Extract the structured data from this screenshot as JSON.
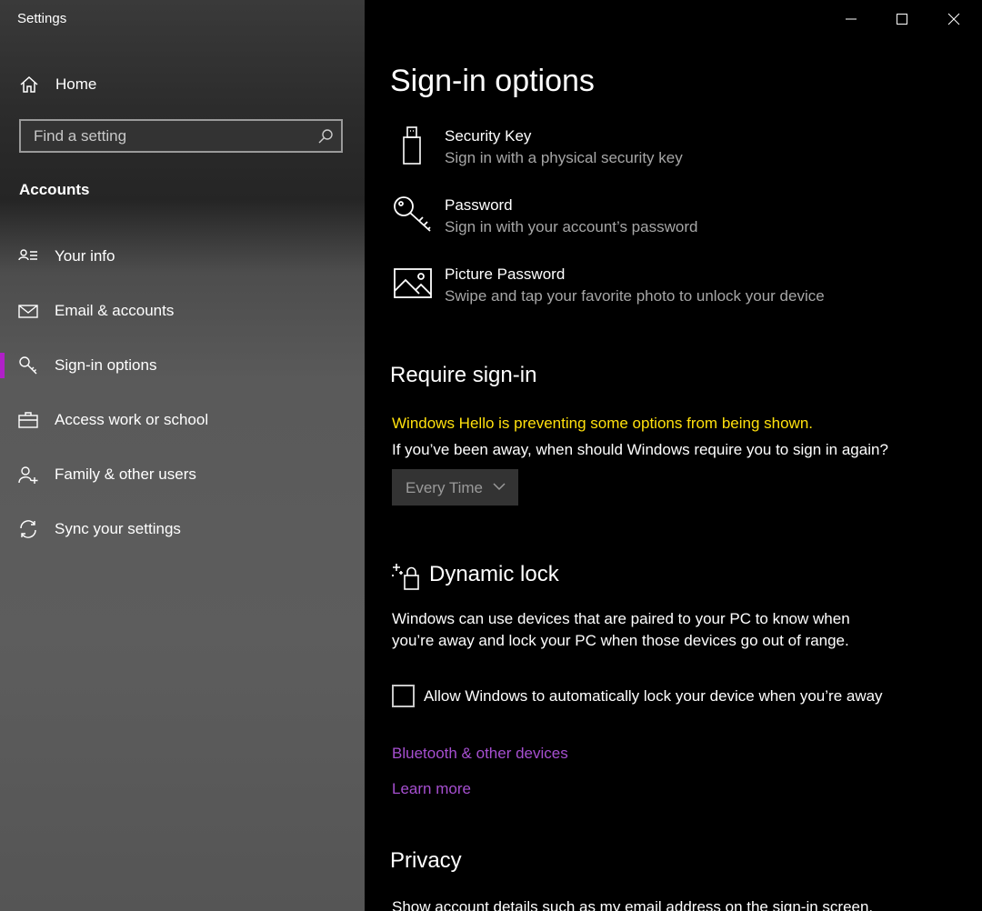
{
  "window": {
    "title": "Settings"
  },
  "sidebar": {
    "home_label": "Home",
    "search_placeholder": "Find a setting",
    "section": "Accounts",
    "items": [
      {
        "label": "Your info",
        "icon": "person-list-icon"
      },
      {
        "label": "Email & accounts",
        "icon": "mail-icon"
      },
      {
        "label": "Sign-in options",
        "icon": "key-icon",
        "active": true
      },
      {
        "label": "Access work or school",
        "icon": "briefcase-icon"
      },
      {
        "label": "Family & other users",
        "icon": "person-add-icon"
      },
      {
        "label": "Sync your settings",
        "icon": "sync-icon"
      }
    ],
    "accent_color": "#b020c8"
  },
  "main": {
    "title": "Sign-in options",
    "options": [
      {
        "title": "Security Key",
        "subtitle": "Sign in with a physical security key",
        "icon": "usb-key-icon"
      },
      {
        "title": "Password",
        "subtitle": "Sign in with your account’s password",
        "icon": "key-icon"
      },
      {
        "title": "Picture Password",
        "subtitle": "Swipe and tap your favorite photo to unlock your device",
        "icon": "picture-icon"
      }
    ],
    "require_signin": {
      "heading": "Require sign-in",
      "warning": "Windows Hello is preventing some options from being shown.",
      "question": "If you’ve been away, when should Windows require you to sign in again?",
      "dropdown_value": "Every Time"
    },
    "dynamic_lock": {
      "heading": "Dynamic lock",
      "description_line1": "Windows can use devices that are paired to your PC to know when",
      "description_line2": "you’re away and lock your PC when those devices go out of range.",
      "checkbox_label": "Allow Windows to automatically lock your device when you’re away",
      "checked": false,
      "link_bluetooth": "Bluetooth & other devices",
      "link_learn": "Learn more"
    },
    "privacy": {
      "heading": "Privacy",
      "description": "Show account details such as my email address on the sign-in screen."
    }
  },
  "colors": {
    "warning": "#ffe00d",
    "link": "#a64fd0"
  }
}
